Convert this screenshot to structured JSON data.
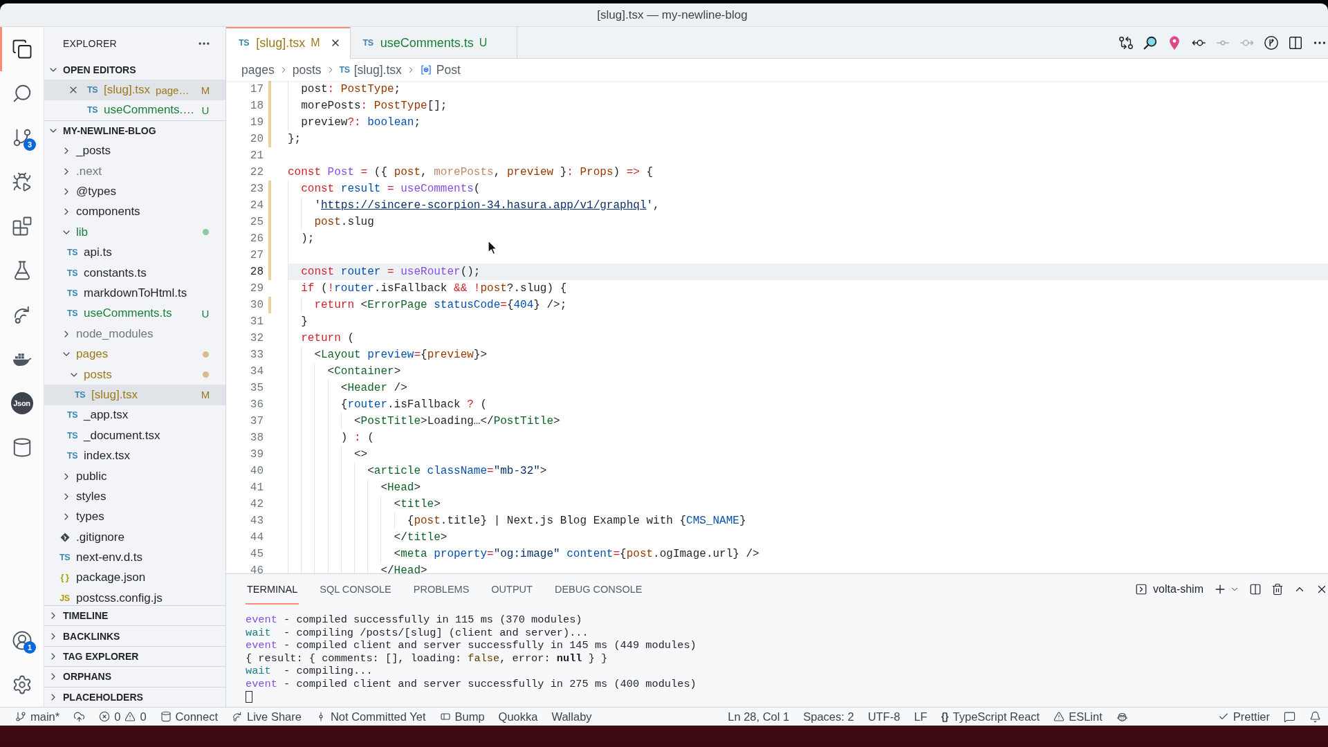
{
  "window": {
    "title": "[slug].tsx — my-newline-blog"
  },
  "activity_bar": {
    "top": [
      {
        "kind": "explorer",
        "selected": true
      },
      {
        "kind": "search",
        "selected": false
      },
      {
        "kind": "source-control",
        "selected": false,
        "badge": "3"
      },
      {
        "kind": "run-debug",
        "selected": false
      },
      {
        "kind": "extensions",
        "selected": false
      },
      {
        "kind": "testing",
        "selected": false
      },
      {
        "kind": "remote",
        "selected": false
      },
      {
        "kind": "docker",
        "selected": false
      },
      {
        "kind": "json",
        "selected": false,
        "text": "Json"
      },
      {
        "kind": "database",
        "selected": false
      }
    ],
    "bottom": [
      {
        "kind": "accounts",
        "badge": "1"
      },
      {
        "kind": "settings"
      }
    ]
  },
  "sidebar": {
    "title": "EXPLORER",
    "open_editors": {
      "title": "OPEN EDITORS",
      "expanded": true,
      "items": [
        {
          "icon": "TS",
          "name": "[slug].tsx",
          "description": "page…",
          "badge": "M",
          "color": "#9c7a1c",
          "selected": true
        },
        {
          "icon": "TS",
          "name": "useComments.…",
          "badge": "U",
          "color": "#1a7f37",
          "selected": false
        }
      ]
    },
    "folder": {
      "title": "MY-NEWLINE-BLOG",
      "expanded": true,
      "tree": [
        {
          "kind": "folder",
          "name": "_posts",
          "expanded": false,
          "selected": false
        },
        {
          "kind": "folder",
          "name": ".next",
          "expanded": false,
          "selected": false,
          "color": "#6e7781"
        },
        {
          "kind": "folder",
          "name": "@types",
          "expanded": false,
          "selected": false
        },
        {
          "kind": "folder",
          "name": "components",
          "expanded": false,
          "selected": false
        },
        {
          "kind": "folder",
          "name": "lib",
          "expanded": true,
          "selected": false,
          "color": "#1a7f37",
          "dot": {
            "color": "#8fc9a0"
          },
          "children": [
            {
              "kind": "ts",
              "icon": "TS",
              "name": "api.ts",
              "selected": false
            },
            {
              "kind": "ts",
              "icon": "TS",
              "name": "constants.ts",
              "selected": false
            },
            {
              "kind": "ts",
              "icon": "TS",
              "name": "markdownToHtml.ts",
              "selected": false
            },
            {
              "kind": "ts",
              "icon": "TS",
              "name": "useComments.ts",
              "selected": false,
              "color": "#1a7f37",
              "badge": "U"
            }
          ]
        },
        {
          "kind": "folder",
          "name": "node_modules",
          "expanded": false,
          "selected": false,
          "color": "#6e7781"
        },
        {
          "kind": "folder",
          "name": "pages",
          "expanded": true,
          "selected": false,
          "color": "#9c7a1c",
          "dot": {
            "color": "#d9bb8c"
          },
          "children": [
            {
              "kind": "folder",
              "name": "posts",
              "expanded": true,
              "selected": false,
              "color": "#9c7a1c",
              "dot": {
                "color": "#d9bb8c"
              },
              "children": [
                {
                  "kind": "ts",
                  "icon": "TS",
                  "name": "[slug].tsx",
                  "selected": true,
                  "color": "#9c7a1c",
                  "badge": "M"
                }
              ]
            },
            {
              "kind": "ts",
              "icon": "TS",
              "name": "_app.tsx",
              "selected": false
            },
            {
              "kind": "ts",
              "icon": "TS",
              "name": "_document.tsx",
              "selected": false
            },
            {
              "kind": "ts",
              "icon": "TS",
              "name": "index.tsx",
              "selected": false
            }
          ]
        },
        {
          "kind": "folder",
          "name": "public",
          "expanded": false,
          "selected": false
        },
        {
          "kind": "folder",
          "name": "styles",
          "expanded": false,
          "selected": false
        },
        {
          "kind": "folder",
          "name": "types",
          "expanded": false,
          "selected": false
        },
        {
          "kind": "git",
          "name": ".gitignore",
          "selected": false
        },
        {
          "kind": "ts",
          "icon": "TS",
          "name": "next-env.d.ts",
          "selected": false
        },
        {
          "kind": "json",
          "icon": "{ }",
          "name": "package.json",
          "selected": false
        },
        {
          "kind": "js",
          "icon": "JS",
          "name": "postcss.config.js",
          "selected": false
        }
      ]
    },
    "sections": [
      {
        "title": "TIMELINE",
        "expanded": false
      },
      {
        "title": "BACKLINKS",
        "expanded": false
      },
      {
        "title": "TAG EXPLORER",
        "expanded": false
      },
      {
        "title": "ORPHANS",
        "expanded": false
      },
      {
        "title": "PLACEHOLDERS",
        "expanded": false
      }
    ]
  },
  "editor": {
    "tabs": [
      {
        "icon": "TS",
        "label": "[slug].tsx",
        "badge": "M",
        "color": "#9c7a1c",
        "selected": true
      },
      {
        "icon": "TS",
        "label": "useComments.ts",
        "badge": "U",
        "color": "#1a7f37",
        "selected": false
      }
    ],
    "actions": [
      {
        "kind": "compare",
        "disabled": false
      },
      {
        "kind": "inspect",
        "disabled": false
      },
      {
        "kind": "pin",
        "disabled": false
      },
      {
        "kind": "previous",
        "disabled": false
      },
      {
        "kind": "commit",
        "disabled": true
      },
      {
        "kind": "next",
        "disabled": true
      },
      {
        "kind": "git-graph",
        "disabled": false
      },
      {
        "kind": "split",
        "disabled": false
      },
      {
        "kind": "more",
        "disabled": false
      }
    ],
    "breadcrumb": [
      {
        "kind": "folder",
        "text": "pages"
      },
      {
        "kind": "folder",
        "text": "posts"
      },
      {
        "kind": "ts",
        "icon": "TS",
        "text": "[slug].tsx"
      },
      {
        "kind": "symbol",
        "text": "Post"
      }
    ],
    "lines": [
      {
        "number": "17",
        "changed": true,
        "current": false,
        "tokens": [
          {
            "kind": "text",
            "text": "  post"
          },
          {
            "kind": "keyword",
            "text": ": "
          },
          {
            "kind": "variable",
            "text": "PostType"
          },
          {
            "kind": "text",
            "text": ";"
          }
        ]
      },
      {
        "number": "18",
        "changed": true,
        "current": false,
        "tokens": [
          {
            "kind": "text",
            "text": "  morePosts"
          },
          {
            "kind": "keyword",
            "text": ": "
          },
          {
            "kind": "variable",
            "text": "PostType"
          },
          {
            "kind": "text",
            "text": "[];"
          }
        ]
      },
      {
        "number": "19",
        "changed": true,
        "current": false,
        "tokens": [
          {
            "kind": "text",
            "text": "  preview"
          },
          {
            "kind": "keyword",
            "text": "?: "
          },
          {
            "kind": "constant",
            "text": "boolean"
          },
          {
            "kind": "text",
            "text": ";"
          }
        ]
      },
      {
        "number": "20",
        "changed": true,
        "current": false,
        "tokens": [
          {
            "kind": "text",
            "text": "};"
          }
        ]
      },
      {
        "number": "21",
        "changed": false,
        "current": false
      },
      {
        "number": "22",
        "changed": false,
        "current": false,
        "tokens": [
          {
            "kind": "keyword",
            "text": "const "
          },
          {
            "kind": "function",
            "text": "Post"
          },
          {
            "kind": "keyword",
            "text": " = "
          },
          {
            "kind": "text",
            "text": "({ "
          },
          {
            "kind": "variable",
            "text": "post"
          },
          {
            "kind": "text",
            "text": ", "
          },
          {
            "kind": "unused",
            "text": "morePosts"
          },
          {
            "kind": "text",
            "text": ", "
          },
          {
            "kind": "variable",
            "text": "preview"
          },
          {
            "kind": "text",
            "text": " }"
          },
          {
            "kind": "keyword",
            "text": ": "
          },
          {
            "kind": "variable",
            "text": "Props"
          },
          {
            "kind": "text",
            "text": ") "
          },
          {
            "kind": "keyword",
            "text": "=>"
          },
          {
            "kind": "text",
            "text": " {"
          }
        ]
      },
      {
        "number": "23",
        "changed": true,
        "current": false,
        "tokens": [
          {
            "kind": "keyword",
            "text": "  const "
          },
          {
            "kind": "constant",
            "text": "result"
          },
          {
            "kind": "keyword",
            "text": " = "
          },
          {
            "kind": "function",
            "text": "useComments"
          },
          {
            "kind": "text",
            "text": "("
          }
        ]
      },
      {
        "number": "24",
        "changed": true,
        "current": false,
        "tokens": [
          {
            "kind": "string",
            "text": "    '"
          },
          {
            "kind": "link",
            "text": "https://sincere-scorpion-34.hasura.app/v1/graphql"
          },
          {
            "kind": "string",
            "text": "'"
          },
          {
            "kind": "text",
            "text": ","
          }
        ]
      },
      {
        "number": "25",
        "changed": true,
        "current": false,
        "tokens": [
          {
            "kind": "variable",
            "text": "    post"
          },
          {
            "kind": "text",
            "text": ".slug"
          }
        ]
      },
      {
        "number": "26",
        "changed": true,
        "current": false,
        "tokens": [
          {
            "kind": "text",
            "text": "  );"
          }
        ]
      },
      {
        "number": "27",
        "changed": true,
        "current": false
      },
      {
        "number": "28",
        "changed": true,
        "current": true,
        "tokens": [
          {
            "kind": "keyword",
            "text": "  const "
          },
          {
            "kind": "constant",
            "text": "router"
          },
          {
            "kind": "keyword",
            "text": " = "
          },
          {
            "kind": "function",
            "text": "useRouter"
          },
          {
            "kind": "text",
            "text": "();"
          }
        ]
      },
      {
        "number": "29",
        "changed": false,
        "current": false,
        "tokens": [
          {
            "kind": "keyword",
            "text": "  if "
          },
          {
            "kind": "text",
            "text": "("
          },
          {
            "kind": "keyword",
            "text": "!"
          },
          {
            "kind": "constant",
            "text": "router"
          },
          {
            "kind": "text",
            "text": ".isFallback "
          },
          {
            "kind": "keyword",
            "text": "&& !"
          },
          {
            "kind": "variable",
            "text": "post"
          },
          {
            "kind": "text",
            "text": "?.slug) {"
          }
        ]
      },
      {
        "number": "30",
        "changed": true,
        "current": false,
        "tokens": [
          {
            "kind": "keyword",
            "text": "    return "
          },
          {
            "kind": "text",
            "text": "<"
          },
          {
            "kind": "tag",
            "text": "ErrorPage"
          },
          {
            "kind": "constant",
            "text": " statusCode"
          },
          {
            "kind": "keyword",
            "text": "="
          },
          {
            "kind": "text",
            "text": "{"
          },
          {
            "kind": "constant",
            "text": "404"
          },
          {
            "kind": "text",
            "text": "} />;"
          }
        ]
      },
      {
        "number": "31",
        "changed": false,
        "current": false,
        "tokens": [
          {
            "kind": "text",
            "text": "  }"
          }
        ]
      },
      {
        "number": "32",
        "changed": false,
        "current": false,
        "tokens": [
          {
            "kind": "keyword",
            "text": "  return "
          },
          {
            "kind": "text",
            "text": "("
          }
        ]
      },
      {
        "number": "33",
        "changed": false,
        "current": false,
        "tokens": [
          {
            "kind": "text",
            "text": "    <"
          },
          {
            "kind": "tag",
            "text": "Layout"
          },
          {
            "kind": "constant",
            "text": " preview"
          },
          {
            "kind": "keyword",
            "text": "="
          },
          {
            "kind": "text",
            "text": "{"
          },
          {
            "kind": "variable",
            "text": "preview"
          },
          {
            "kind": "text",
            "text": "}>"
          }
        ]
      },
      {
        "number": "34",
        "changed": false,
        "current": false,
        "tokens": [
          {
            "kind": "text",
            "text": "      <"
          },
          {
            "kind": "tag",
            "text": "Container"
          },
          {
            "kind": "text",
            "text": ">"
          }
        ]
      },
      {
        "number": "35",
        "changed": false,
        "current": false,
        "tokens": [
          {
            "kind": "text",
            "text": "        <"
          },
          {
            "kind": "tag",
            "text": "Header"
          },
          {
            "kind": "text",
            "text": " />"
          }
        ]
      },
      {
        "number": "36",
        "changed": false,
        "current": false,
        "tokens": [
          {
            "kind": "text",
            "text": "        {"
          },
          {
            "kind": "constant",
            "text": "router"
          },
          {
            "kind": "text",
            "text": ".isFallback "
          },
          {
            "kind": "keyword",
            "text": "?"
          },
          {
            "kind": "text",
            "text": " ("
          }
        ]
      },
      {
        "number": "37",
        "changed": false,
        "current": false,
        "tokens": [
          {
            "kind": "text",
            "text": "          <"
          },
          {
            "kind": "tag",
            "text": "PostTitle"
          },
          {
            "kind": "text",
            "text": ">Loading…</"
          },
          {
            "kind": "tag",
            "text": "PostTitle"
          },
          {
            "kind": "text",
            "text": ">"
          }
        ]
      },
      {
        "number": "38",
        "changed": false,
        "current": false,
        "tokens": [
          {
            "kind": "text",
            "text": "        ) "
          },
          {
            "kind": "keyword",
            "text": ":"
          },
          {
            "kind": "text",
            "text": " ("
          }
        ]
      },
      {
        "number": "39",
        "changed": false,
        "current": false,
        "tokens": [
          {
            "kind": "text",
            "text": "          <>"
          }
        ]
      },
      {
        "number": "40",
        "changed": false,
        "current": false,
        "tokens": [
          {
            "kind": "text",
            "text": "            <"
          },
          {
            "kind": "tag",
            "text": "article"
          },
          {
            "kind": "constant",
            "text": " className"
          },
          {
            "kind": "keyword",
            "text": "="
          },
          {
            "kind": "string",
            "text": "\"mb-32\""
          },
          {
            "kind": "text",
            "text": ">"
          }
        ]
      },
      {
        "number": "41",
        "changed": false,
        "current": false,
        "tokens": [
          {
            "kind": "text",
            "text": "              <"
          },
          {
            "kind": "tag",
            "text": "Head"
          },
          {
            "kind": "text",
            "text": ">"
          }
        ]
      },
      {
        "number": "42",
        "changed": false,
        "current": false,
        "tokens": [
          {
            "kind": "text",
            "text": "                <"
          },
          {
            "kind": "tag",
            "text": "title"
          },
          {
            "kind": "text",
            "text": ">"
          }
        ]
      },
      {
        "number": "43",
        "changed": false,
        "current": false,
        "tokens": [
          {
            "kind": "text",
            "text": "                  {"
          },
          {
            "kind": "variable",
            "text": "post"
          },
          {
            "kind": "text",
            "text": ".title} | Next.js Blog Example with {"
          },
          {
            "kind": "constant",
            "text": "CMS_NAME"
          },
          {
            "kind": "text",
            "text": "}"
          }
        ]
      },
      {
        "number": "44",
        "changed": false,
        "current": false,
        "tokens": [
          {
            "kind": "text",
            "text": "                </"
          },
          {
            "kind": "tag",
            "text": "title"
          },
          {
            "kind": "text",
            "text": ">"
          }
        ]
      },
      {
        "number": "45",
        "changed": false,
        "current": false,
        "tokens": [
          {
            "kind": "text",
            "text": "                <"
          },
          {
            "kind": "tag",
            "text": "meta"
          },
          {
            "kind": "constant",
            "text": " property"
          },
          {
            "kind": "keyword",
            "text": "="
          },
          {
            "kind": "string",
            "text": "\"og:image\""
          },
          {
            "kind": "constant",
            "text": " content"
          },
          {
            "kind": "keyword",
            "text": "="
          },
          {
            "kind": "text",
            "text": "{"
          },
          {
            "kind": "variable",
            "text": "post"
          },
          {
            "kind": "text",
            "text": ".ogImage.url} />"
          }
        ]
      },
      {
        "number": "46",
        "changed": false,
        "current": false,
        "tokens": [
          {
            "kind": "text",
            "text": "              </"
          },
          {
            "kind": "tag",
            "text": "Head"
          },
          {
            "kind": "text",
            "text": ">"
          }
        ]
      }
    ]
  },
  "panel": {
    "tabs": [
      {
        "label": "TERMINAL",
        "selected": true
      },
      {
        "label": "SQL CONSOLE",
        "selected": false
      },
      {
        "label": "PROBLEMS",
        "selected": false
      },
      {
        "label": "OUTPUT",
        "selected": false
      },
      {
        "label": "DEBUG CONSOLE",
        "selected": false
      }
    ],
    "terminal_name": "volta-shim",
    "actions": [
      {
        "kind": "add"
      },
      {
        "kind": "dropdown"
      },
      {
        "kind": "split"
      },
      {
        "kind": "trash"
      },
      {
        "kind": "maximize"
      },
      {
        "kind": "close"
      }
    ],
    "terminal_lines": [
      {
        "tokens": [
          {
            "kind": "event",
            "text": "event"
          },
          {
            "kind": "text",
            "text": " - compiled successfully in 115 ms (370 modules)"
          }
        ]
      },
      {
        "tokens": [
          {
            "kind": "wait",
            "text": "wait"
          },
          {
            "kind": "text",
            "text": "  - compiling /posts/[slug] (client and server)..."
          }
        ]
      },
      {
        "tokens": [
          {
            "kind": "event",
            "text": "event"
          },
          {
            "kind": "text",
            "text": " - compiled client and server successfully in 145 ms (449 modules)"
          }
        ]
      },
      {
        "tokens": [
          {
            "kind": "text",
            "text": "{ result: { comments: [], loading: "
          },
          {
            "kind": "boolean",
            "text": "false"
          },
          {
            "kind": "text",
            "text": ", error: "
          },
          {
            "kind": "null",
            "text": "null"
          },
          {
            "kind": "text",
            "text": " } }"
          }
        ]
      },
      {
        "tokens": [
          {
            "kind": "wait",
            "text": "wait"
          },
          {
            "kind": "text",
            "text": "  - compiling..."
          }
        ]
      },
      {
        "tokens": [
          {
            "kind": "event",
            "text": "event"
          },
          {
            "kind": "text",
            "text": " - compiled client and server successfully in 275 ms (400 modules)"
          }
        ]
      }
    ]
  },
  "status_bar": {
    "left": [
      {
        "kind": "branch",
        "text": "main*"
      },
      {
        "kind": "sync"
      },
      {
        "kind": "problems",
        "errors": "0",
        "warnings": "0"
      },
      {
        "kind": "database",
        "text": "Connect"
      },
      {
        "kind": "live-share",
        "text": "Live Share"
      },
      {
        "kind": "commit",
        "text": "Not Committed Yet"
      },
      {
        "kind": "bump",
        "text": "Bump"
      },
      {
        "kind": "plain",
        "text": "Quokka"
      },
      {
        "kind": "plain",
        "text": "Wallaby"
      }
    ],
    "right": [
      {
        "kind": "plain",
        "text": "Ln 28, Col 1"
      },
      {
        "kind": "plain",
        "text": "Spaces: 2"
      },
      {
        "kind": "plain",
        "text": "UTF-8"
      },
      {
        "kind": "plain",
        "text": "LF"
      },
      {
        "kind": "language",
        "icon": "{}",
        "text": "TypeScript React"
      },
      {
        "kind": "warning",
        "text": "ESLint"
      },
      {
        "kind": "copilot"
      },
      {
        "kind": "check",
        "text": "Prettier"
      },
      {
        "kind": "feedback"
      },
      {
        "kind": "bell"
      }
    ]
  }
}
